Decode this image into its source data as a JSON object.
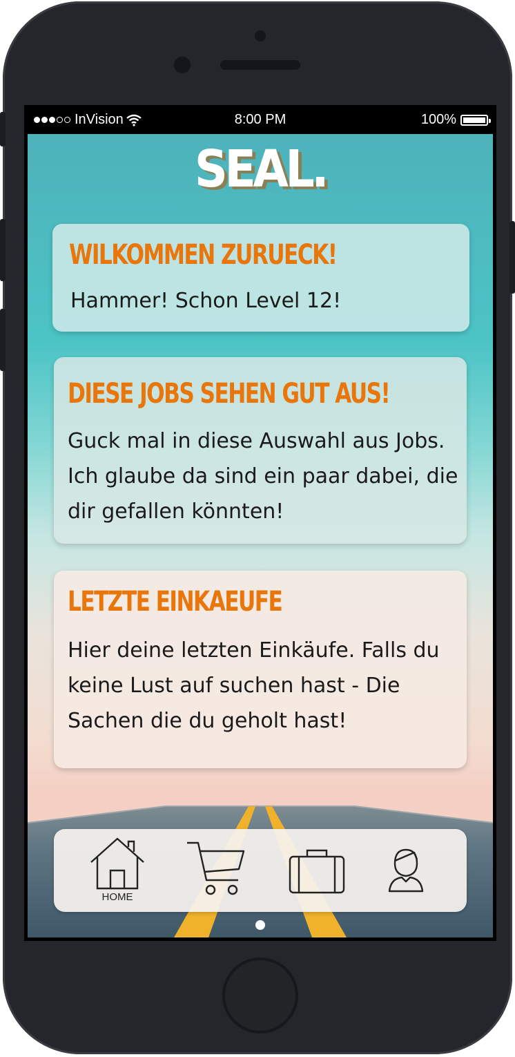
{
  "status_bar": {
    "carrier": "InVision",
    "time": "8:00 PM",
    "battery": "100%"
  },
  "logo": {
    "text": "SEAL."
  },
  "cards": [
    {
      "title": "WILKOMMEN ZURUECK!",
      "body": "Hammer! Schon Level 12!"
    },
    {
      "title": "DIESE JOBS SEHEN GUT AUS!",
      "body": "Guck mal in diese Auswahl aus Jobs. Ich glaube da sind ein paar dabei, die dir gefallen könnten!"
    },
    {
      "title": "LETZTE EINKAEUFE",
      "body": "Hier deine letzten Einkäufe. Falls du keine Lust auf suchen hast - Die Sachen die du geholt hast!"
    }
  ],
  "tab_bar": {
    "items": [
      {
        "icon": "house-icon",
        "label": "HOME"
      },
      {
        "icon": "cart-icon",
        "label": ""
      },
      {
        "icon": "briefcase-icon",
        "label": ""
      },
      {
        "icon": "user-icon",
        "label": ""
      }
    ],
    "active_index": 0
  },
  "colors": {
    "accent": "#e8760a",
    "sky_top": "#4eb2bb",
    "road": "#4c6472",
    "lane": "#f0b22a"
  }
}
